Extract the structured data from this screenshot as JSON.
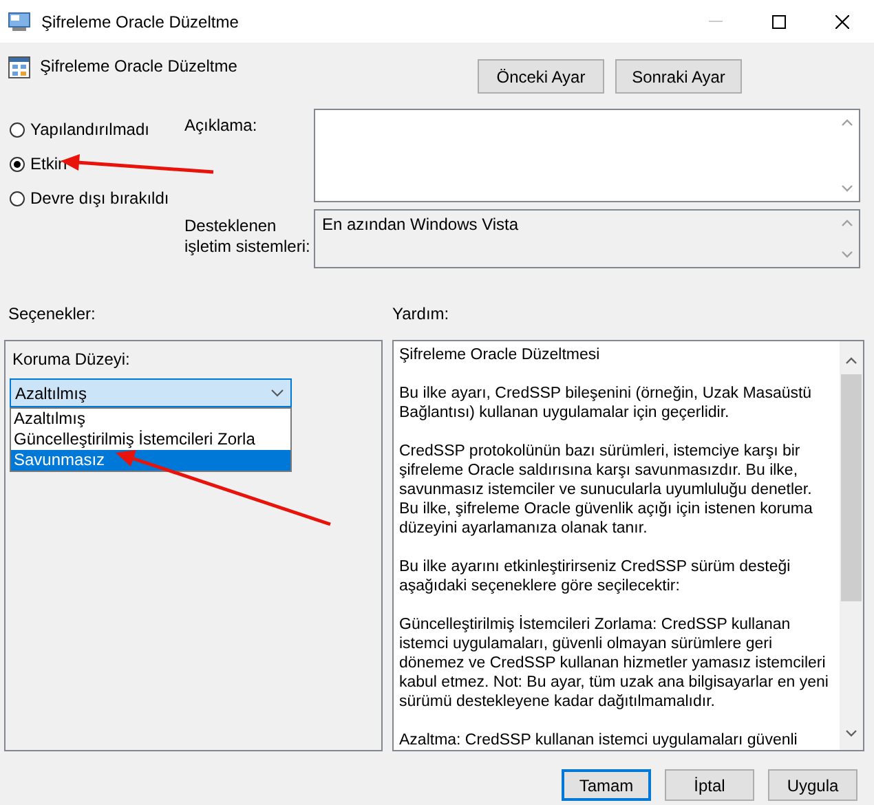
{
  "window": {
    "title": "Şifreleme Oracle Düzeltme"
  },
  "header": {
    "title": "Şifreleme Oracle Düzeltme",
    "buttons": [
      "Önceki Ayar",
      "Sonraki Ayar"
    ]
  },
  "state_options": [
    {
      "label": "Yapılandırılmadı",
      "selected": false
    },
    {
      "label": "Etkin",
      "selected": true
    },
    {
      "label": "Devre dışı bırakıldı",
      "selected": false
    }
  ],
  "comment": {
    "label": "Açıklama:"
  },
  "supported": {
    "label": "Desteklenen işletim sistemleri:",
    "value": "En azından Windows Vista"
  },
  "options": {
    "heading": "Seçenekler:",
    "field_label": "Koruma Düzeyi:",
    "value": "Azaltılmış",
    "expanded": true,
    "items": [
      {
        "label": "Azaltılmış",
        "highlighted": false
      },
      {
        "label": "Güncelleştirilmiş İstemcileri Zorla",
        "highlighted": false
      },
      {
        "label": "Savunmasız",
        "highlighted": true
      }
    ]
  },
  "help": {
    "heading": "Yardım:",
    "paragraphs": [
      "Şifreleme Oracle Düzeltmesi",
      "Bu ilke ayarı, CredSSP bileşenini (örneğin, Uzak Masaüstü Bağlantısı) kullanan uygulamalar için geçerlidir.",
      "CredSSP protokolünün bazı sürümleri, istemciye karşı bir şifreleme Oracle saldırısına karşı savunmasızdır. Bu ilke, savunmasız istemciler ve sunucularla uyumluluğu denetler. Bu ilke, şifreleme Oracle güvenlik açığı için istenen koruma düzeyini ayarlamanıza olanak tanır.",
      "Bu ilke ayarını etkinleştirirseniz CredSSP sürüm desteği aşağıdaki seçeneklere göre seçilecektir:",
      "Güncelleştirilmiş İstemcileri Zorlama: CredSSP kullanan istemci uygulamaları, güvenli olmayan sürümlere geri dönemez ve CredSSP kullanan hizmetler yamasız istemcileri kabul etmez. Not: Bu ayar, tüm uzak ana bilgisayarlar en yeni sürümü destekleyene kadar dağıtılmamalıdır.",
      "Azaltma: CredSSP kullanan istemci uygulamaları güvenli"
    ]
  },
  "footer_buttons": [
    {
      "label": "Tamam",
      "default": true
    },
    {
      "label": "İptal",
      "default": false
    },
    {
      "label": "Uygula",
      "default": false
    }
  ]
}
